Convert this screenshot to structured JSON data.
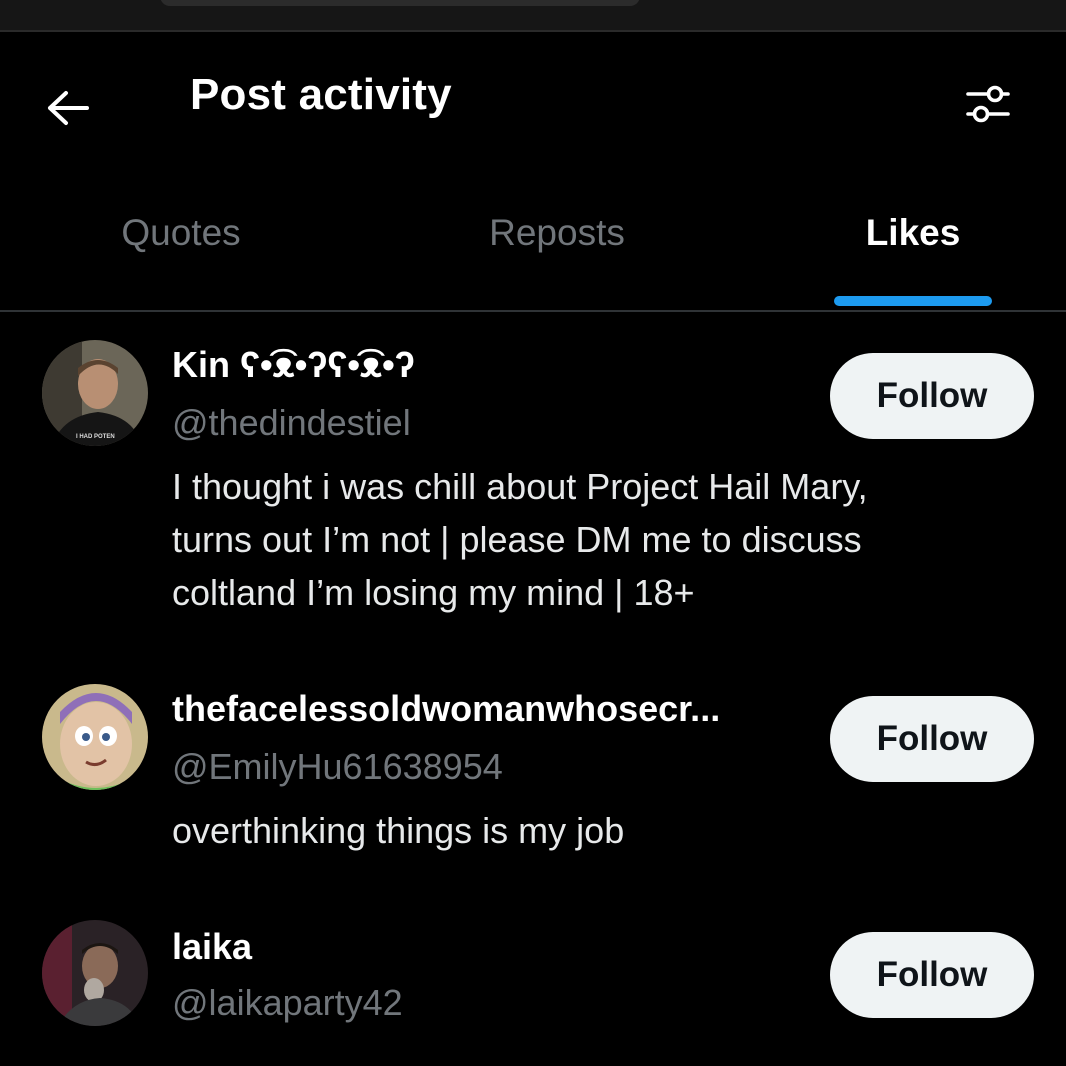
{
  "header": {
    "title": "Post activity",
    "back_icon": "arrow-left-icon",
    "filter_icon": "sliders-icon"
  },
  "tabs": [
    {
      "label": "Quotes",
      "active": false
    },
    {
      "label": "Reposts",
      "active": false
    },
    {
      "label": "Likes",
      "active": true
    }
  ],
  "colors": {
    "accent": "#1d9bf0",
    "background": "#000000",
    "secondary_text": "#71767b",
    "follow_bg": "#eff3f4"
  },
  "users": [
    {
      "display_name": "Kin ʕ•͡ᴥ•ʔʕ•͡ᴥ•ʔ",
      "handle": "@thedindestiel",
      "bio_lines": [
        "I thought i was chill about Project Hail Mary,",
        "turns out I’m not | please DM me to discuss",
        "coltland I’m losing my mind | 18+"
      ],
      "follow_label": "Follow",
      "avatar_text": "I HAD POTEN"
    },
    {
      "display_name": "thefacelessoldwomanwhosecr...",
      "handle": "@EmilyHu61638954",
      "bio_lines": [
        "overthinking things is my job"
      ],
      "follow_label": "Follow"
    },
    {
      "display_name": "laika",
      "handle": "@laikaparty42",
      "bio_lines": [],
      "follow_label": "Follow"
    }
  ]
}
